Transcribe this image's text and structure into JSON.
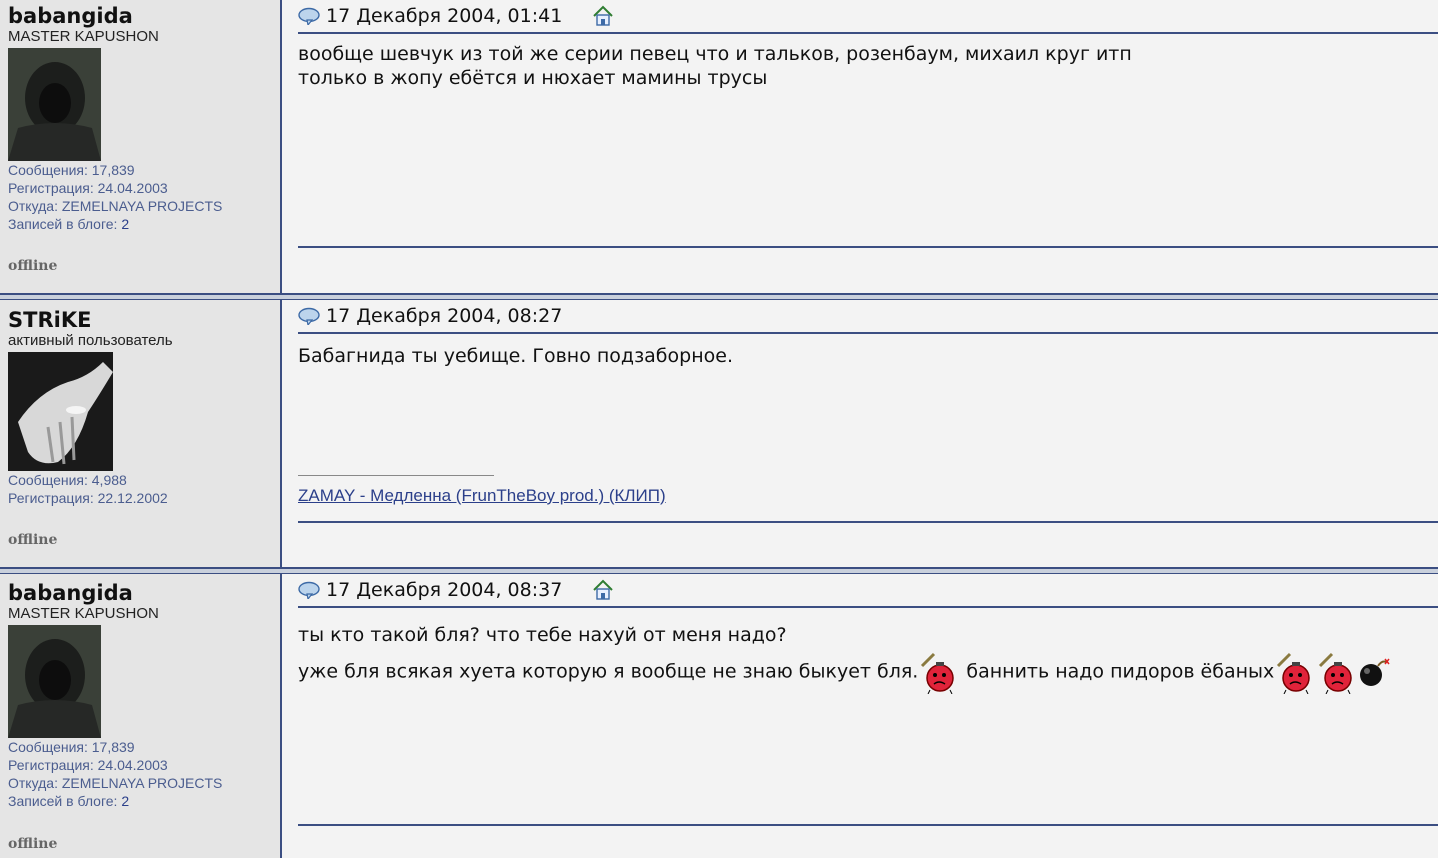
{
  "posts": [
    {
      "username": "babangida",
      "user_title": "MASTER KAPUSHON",
      "stats": [
        {
          "label": "Сообщения:",
          "value": "17,839"
        },
        {
          "label": "Регистрация:",
          "value": "24.04.2003"
        },
        {
          "label": "Откуда:",
          "value": "ZEMELNAYA PROJECTS"
        },
        {
          "label": "Записей в блоге:",
          "value": "2"
        }
      ],
      "status": "offline",
      "date": "17 Декабря 2004, 01:41",
      "lines": [
        "вообще шевчук из той же серии певец что и тальков, розенбаум, михаил круг итп",
        "только в жопу ебётся и нюхает мамины трусы"
      ]
    },
    {
      "username": "STRiKE",
      "user_title": "активный пользователь",
      "stats": [
        {
          "label": "Сообщения:",
          "value": "4,988"
        },
        {
          "label": "Регистрация:",
          "value": "22.12.2002"
        }
      ],
      "status": "offline",
      "date": "17 Декабря 2004, 08:27",
      "lines": [
        "Бабагнида ты уебище. Говно подзаборное."
      ],
      "signature_link": "ZAMAY - Медленна (FrunTheBoy prod.) (КЛИП)"
    },
    {
      "username": "babangida",
      "user_title": "MASTER KAPUSHON",
      "stats": [
        {
          "label": "Сообщения:",
          "value": "17,839"
        },
        {
          "label": "Регистрация:",
          "value": "24.04.2003"
        },
        {
          "label": "Откуда:",
          "value": "ZEMELNAYA PROJECTS"
        },
        {
          "label": "Записей в блоге:",
          "value": "2"
        }
      ],
      "status": "offline",
      "date": "17 Декабря 2004, 08:37",
      "lines": [
        "ты кто такой бля? что тебе нахуй от меня надо?",
        "уже бля всякая хуета которую я вообще не знаю быкует бля.",
        "баннить надо пидоров ёбаных"
      ]
    }
  ],
  "icons": {
    "post_icon": "speech-bubble-icon",
    "home_icon": "home-icon",
    "smiley_angry": "angry-bomb-smiley-icon",
    "smiley_bomb": "bomb-icon"
  },
  "colors": {
    "border": "#3b4e82",
    "userinfo_bg": "#e5e5e5",
    "content_bg": "#f3f3f3",
    "link": "#2b3f8a"
  }
}
